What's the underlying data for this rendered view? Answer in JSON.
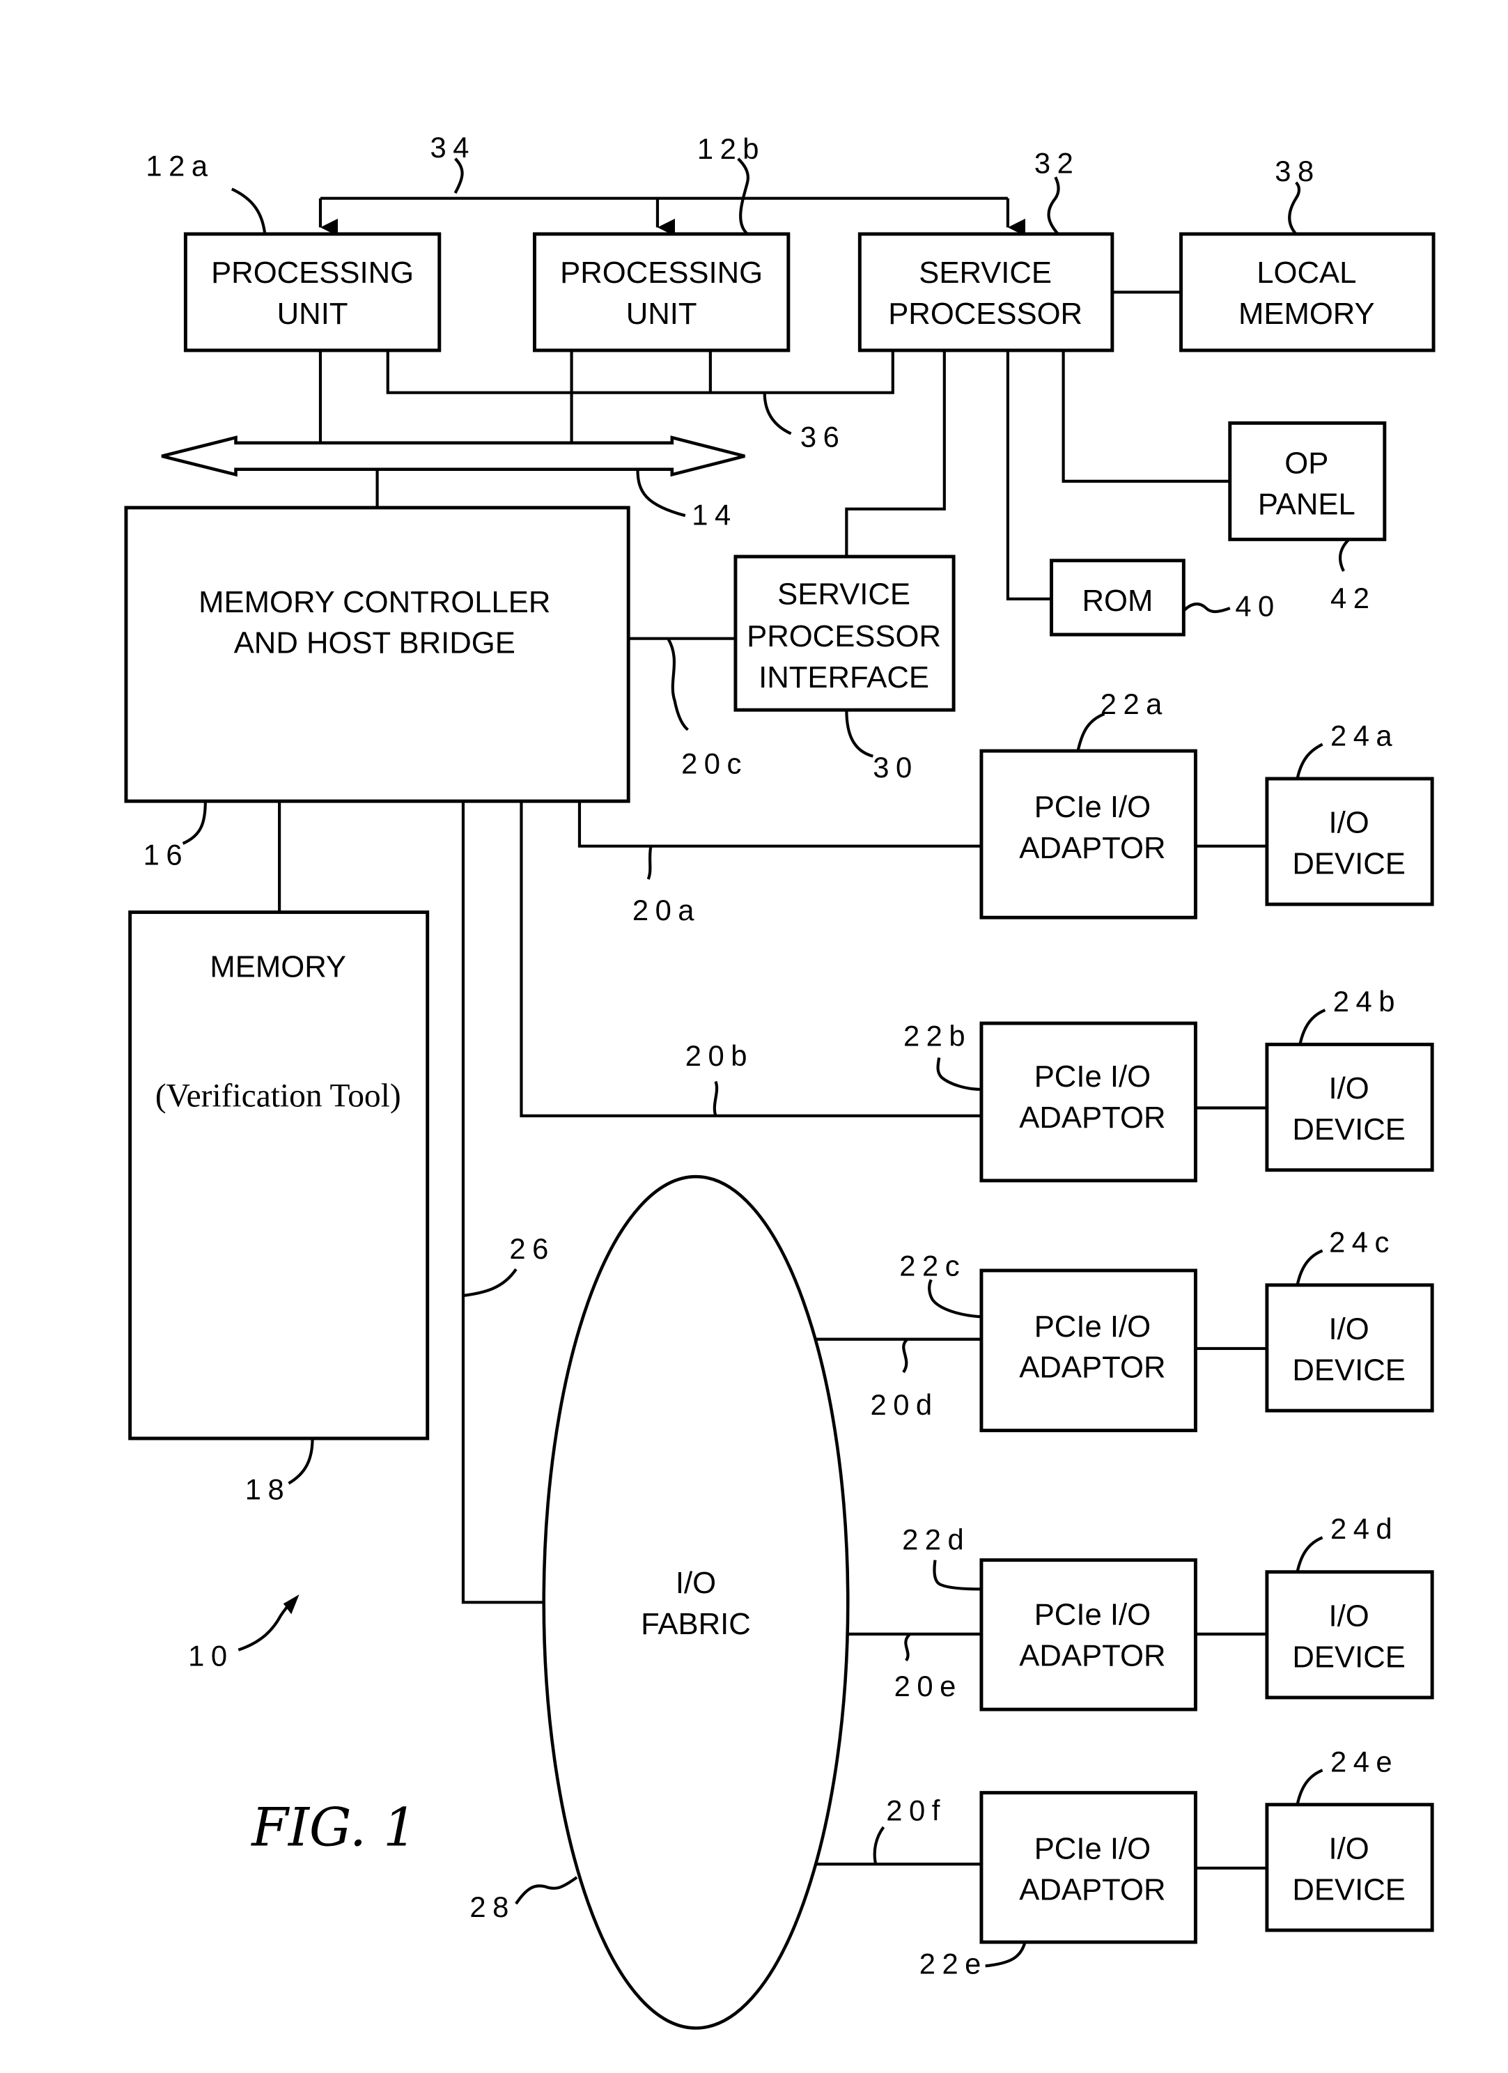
{
  "figure": {
    "label": "FIG. 1",
    "ref": "10"
  },
  "blocks": {
    "pu_a": {
      "lines": [
        "PROCESSING",
        "UNIT"
      ],
      "ref": "12a"
    },
    "pu_b": {
      "lines": [
        "PROCESSING",
        "UNIT"
      ],
      "ref": "12b"
    },
    "service_processor": {
      "lines": [
        "SERVICE",
        "PROCESSOR"
      ],
      "ref": "32"
    },
    "local_memory": {
      "lines": [
        "LOCAL",
        "MEMORY"
      ],
      "ref": "38"
    },
    "op_panel": {
      "lines": [
        "OP",
        "PANEL"
      ],
      "ref": "42"
    },
    "rom": {
      "lines": [
        "ROM"
      ],
      "ref": "40"
    },
    "sp_interface": {
      "lines": [
        "SERVICE",
        "PROCESSOR",
        "INTERFACE"
      ],
      "ref": "30"
    },
    "mem_ctrl": {
      "lines": [
        "MEMORY CONTROLLER",
        "AND HOST BRIDGE"
      ],
      "ref": "16"
    },
    "memory": {
      "lines": [
        "MEMORY"
      ],
      "sub": "(Verification Tool)",
      "ref": "18"
    },
    "io_fabric": {
      "lines": [
        "I/O",
        "FABRIC"
      ],
      "ref": "28"
    }
  },
  "adaptors": [
    {
      "lines": [
        "PCIe I/O",
        "ADAPTOR"
      ],
      "ref": "22a",
      "device": [
        "I/O",
        "DEVICE"
      ],
      "device_ref": "24a",
      "link_ref": "20a"
    },
    {
      "lines": [
        "PCIe I/O",
        "ADAPTOR"
      ],
      "ref": "22b",
      "device": [
        "I/O",
        "DEVICE"
      ],
      "device_ref": "24b",
      "link_ref": "20b"
    },
    {
      "lines": [
        "PCIe I/O",
        "ADAPTOR"
      ],
      "ref": "22c",
      "device": [
        "I/O",
        "DEVICE"
      ],
      "device_ref": "24c",
      "link_ref": "20d"
    },
    {
      "lines": [
        "PCIe I/O",
        "ADAPTOR"
      ],
      "ref": "22d",
      "device": [
        "I/O",
        "DEVICE"
      ],
      "device_ref": "24d",
      "link_ref": "20e"
    },
    {
      "lines": [
        "PCIe I/O",
        "ADAPTOR"
      ],
      "ref": "22e",
      "device": [
        "I/O",
        "DEVICE"
      ],
      "device_ref": "24e",
      "link_ref": "20f"
    }
  ],
  "buses": {
    "system_bus": "14",
    "sp_bus": "34",
    "sp_pu_link": "36",
    "sp_interface_link": "20c",
    "fabric_link": "26"
  }
}
